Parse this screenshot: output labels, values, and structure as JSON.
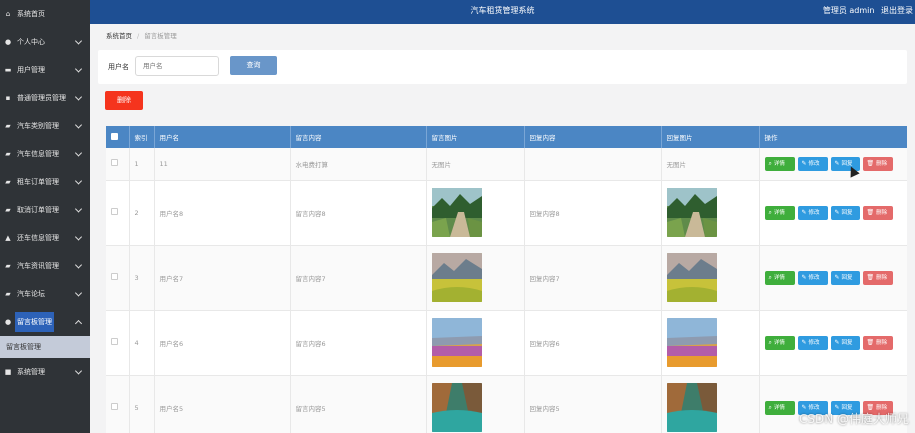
{
  "header": {
    "title": "汽车租赁管理系统",
    "user_label": "管理员 admin",
    "logout": "退出登录"
  },
  "sidebar": {
    "items": [
      {
        "label": "系统首页",
        "icon": "home-icon"
      },
      {
        "label": "个人中心",
        "icon": "user-icon"
      },
      {
        "label": "用户管理",
        "icon": "monitor-icon"
      },
      {
        "label": "普通管理员管理",
        "icon": "card-icon"
      },
      {
        "label": "汽车类别管理",
        "icon": "car-icon"
      },
      {
        "label": "汽车信息管理",
        "icon": "car-icon"
      },
      {
        "label": "租车订单管理",
        "icon": "car-icon"
      },
      {
        "label": "取消订单管理",
        "icon": "car-icon"
      },
      {
        "label": "还车信息管理",
        "icon": "thumb-icon"
      },
      {
        "label": "汽车资讯管理",
        "icon": "car-icon"
      },
      {
        "label": "汽车论坛",
        "icon": "car-icon"
      },
      {
        "label": "留言板管理",
        "icon": "user-icon"
      },
      {
        "label": "系统管理",
        "icon": "briefcase-icon"
      }
    ],
    "sub_item": "留言板管理"
  },
  "breadcrumb": {
    "home": "系统首页",
    "sep": "/",
    "current": "留言板管理"
  },
  "search": {
    "label": "用户名",
    "placeholder": "用户名",
    "button": "查询"
  },
  "delete_button": "删除",
  "table": {
    "columns": [
      "索引",
      "用户名",
      "留言内容",
      "留言图片",
      "回复内容",
      "回复图片",
      "操作"
    ],
    "rows": [
      {
        "index": "1",
        "username": "11",
        "content": "水电费打算",
        "image": "无图片",
        "reply": "",
        "reply_image": "无图片"
      },
      {
        "index": "2",
        "username": "用户名8",
        "content": "留言内容8",
        "image": "forest",
        "reply": "回复内容8",
        "reply_image": "forest"
      },
      {
        "index": "3",
        "username": "用户名7",
        "content": "留言内容7",
        "image": "meadow",
        "reply": "回复内容7",
        "reply_image": "meadow"
      },
      {
        "index": "4",
        "username": "用户名6",
        "content": "留言内容6",
        "image": "flowers",
        "reply": "回复内容6",
        "reply_image": "flowers"
      },
      {
        "index": "5",
        "username": "用户名5",
        "content": "留言内容5",
        "image": "lake",
        "reply": "回复内容5",
        "reply_image": "lake"
      }
    ],
    "actions": {
      "detail": "详情",
      "edit": "修改",
      "reply": "回复",
      "remove": "删除"
    }
  },
  "watermark": "CSDN @伟庭大师兄",
  "colors": {
    "header": "#1e4f93",
    "sidebar": "#2f3337",
    "table_head": "#4b86c4",
    "danger": "#f5341d",
    "success": "#3fae3c",
    "primary": "#2f9be0"
  }
}
